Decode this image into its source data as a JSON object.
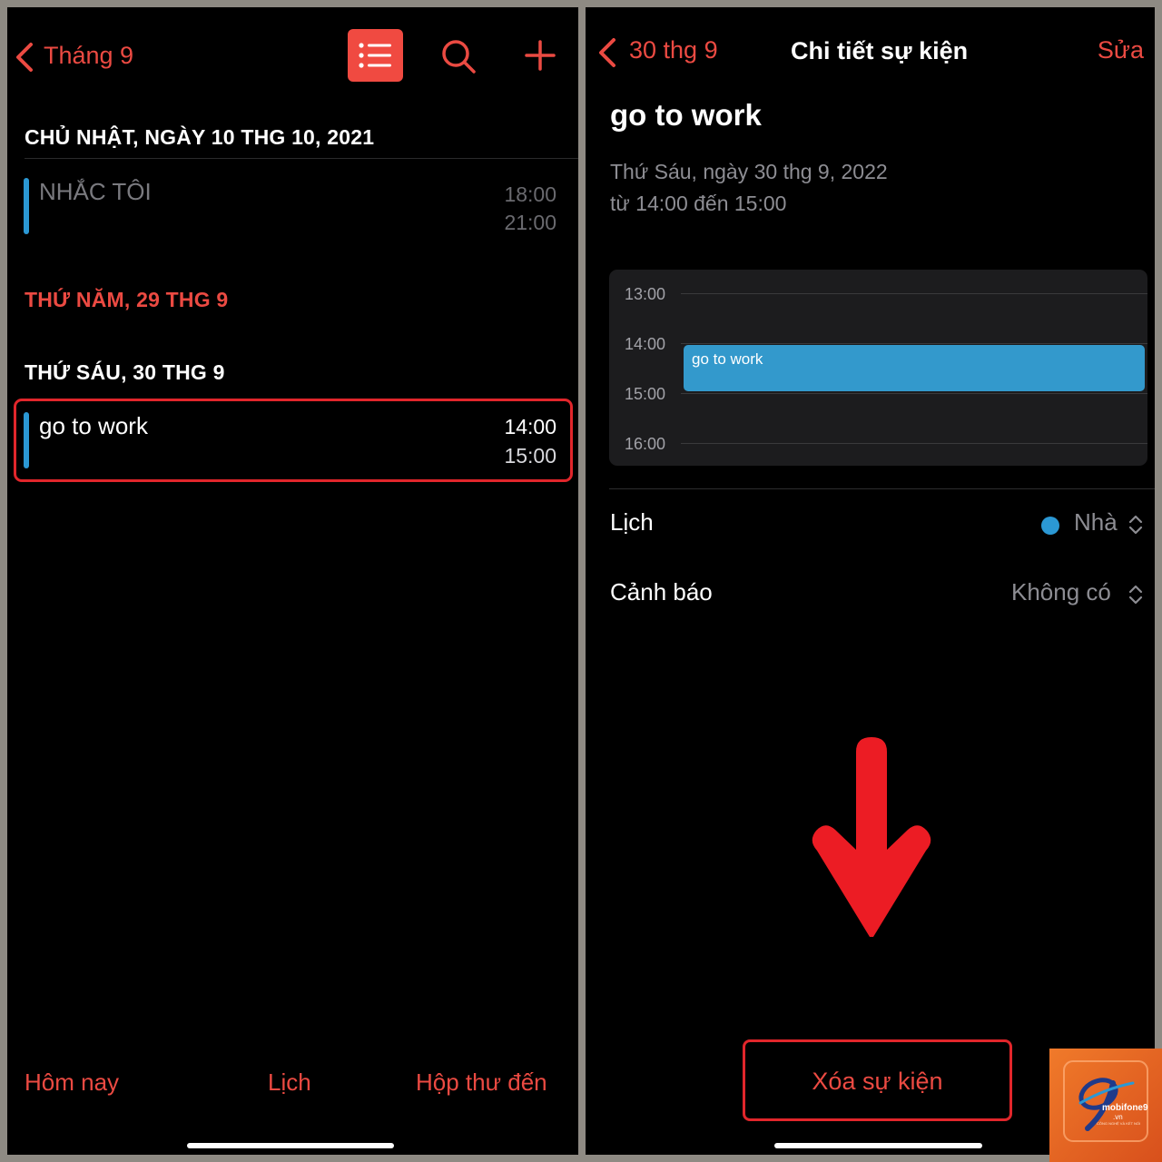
{
  "left_screen": {
    "header": {
      "back_label": "Tháng 9",
      "list_icon": "list-icon",
      "search_icon": "search-icon",
      "add_icon": "plus-icon"
    },
    "sections": [
      {
        "heading": "CHỦ NHẬT, NGÀY 10 THG 10, 2021",
        "events": [
          {
            "title": "NHẮC TÔI",
            "start": "18:00",
            "end": "21:00"
          }
        ]
      },
      {
        "heading": "THỨ NĂM, 29 THG 9",
        "events": []
      },
      {
        "heading": "THỨ SÁU, 30 THG 9",
        "events": [
          {
            "title": "go to work",
            "start": "14:00",
            "end": "15:00"
          }
        ]
      }
    ],
    "tabbar": {
      "today": "Hôm nay",
      "calendars": "Lịch",
      "inbox": "Hộp thư đến"
    }
  },
  "right_screen": {
    "nav": {
      "back_label": "30 thg 9",
      "title": "Chi tiết sự kiện",
      "edit": "Sửa"
    },
    "event": {
      "title": "go to work",
      "date_line": "Thứ Sáu, ngày 30 thg 9, 2022",
      "time_line": "từ 14:00 đến 15:00"
    },
    "mini_calendar": {
      "hours": [
        "13:00",
        "14:00",
        "15:00",
        "16:00"
      ],
      "event_label": "go to work"
    },
    "rows": [
      {
        "label": "Lịch",
        "value": "Nhà"
      },
      {
        "label": "Cảnh báo",
        "value": "Không có"
      }
    ],
    "delete_label": "Xóa sự kiện",
    "arrow_icon": "down-arrow-icon"
  },
  "watermark": {
    "logo_icon": "mobifone9-logo",
    "text": "mobifone9",
    "domain": ".vn",
    "tagline": "CÔNG NGHỆ VÀ KẾT NỐI"
  },
  "colors": {
    "accent": "#eb4a42",
    "event_blue": "#2b98d4",
    "annotation_red": "#e1262b"
  }
}
